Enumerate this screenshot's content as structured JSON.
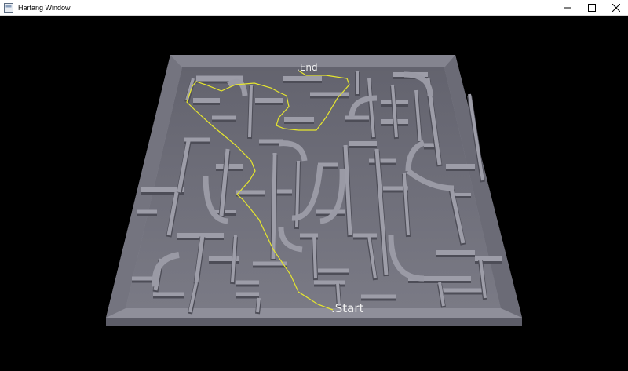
{
  "window": {
    "title": "Harfang Window",
    "controls": {
      "minimize": "—",
      "maximize": "☐",
      "close": "✕"
    }
  },
  "scene": {
    "start_label": ".Start",
    "end_label": ".End",
    "colors": {
      "background": "#000000",
      "floor": "#6f6f7a",
      "wall_top": "#9d9da8",
      "wall_side": "#55555f",
      "path": "#e6e62e"
    }
  }
}
